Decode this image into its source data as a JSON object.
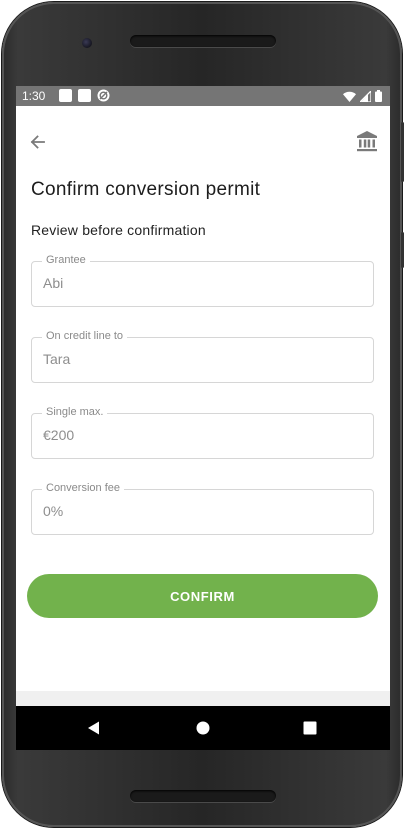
{
  "status_bar": {
    "time": "1:30"
  },
  "header": {
    "back_icon": "arrow-left-icon",
    "bank_icon": "bank-icon"
  },
  "page": {
    "title": "Confirm conversion permit",
    "subtitle": "Review before confirmation"
  },
  "fields": [
    {
      "label": "Grantee",
      "value": "Abi"
    },
    {
      "label": "On credit line to",
      "value": "Tara"
    },
    {
      "label": "Single max.",
      "value": "€200"
    },
    {
      "label": "Conversion fee",
      "value": "0%"
    }
  ],
  "actions": {
    "confirm_label": "CONFIRM",
    "confirm_color": "#72b24c"
  },
  "nav": {
    "back_icon": "triangle-back-icon",
    "home_icon": "circle-home-icon",
    "recents_icon": "square-recents-icon"
  }
}
